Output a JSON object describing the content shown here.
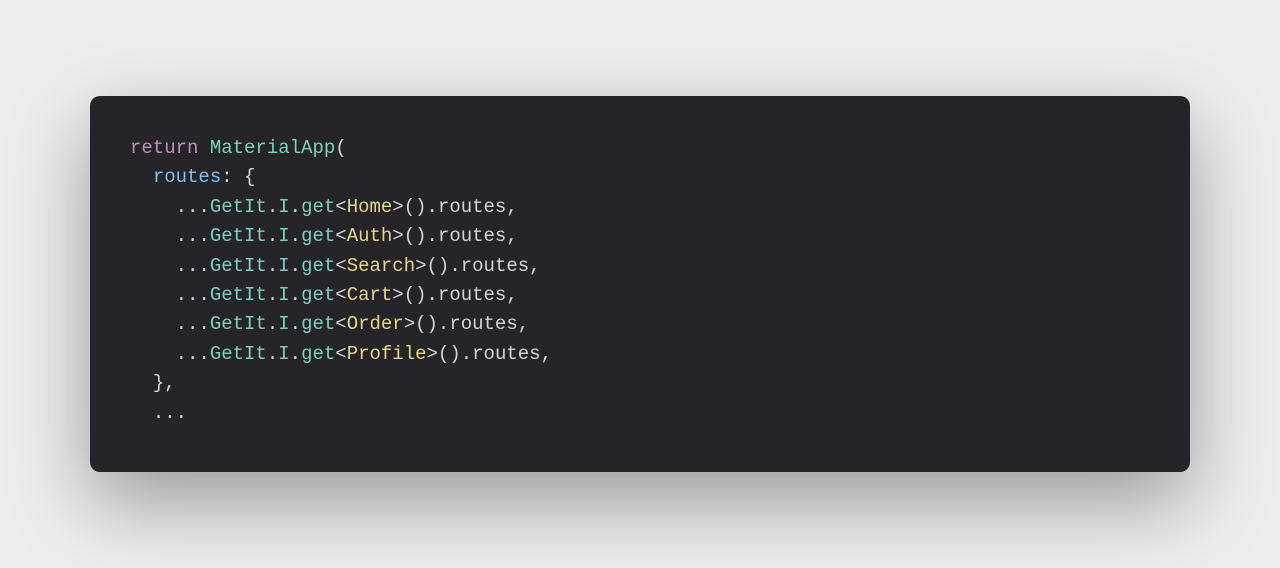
{
  "code": {
    "line1": {
      "return": "return",
      "space": " ",
      "materialApp": "MaterialApp",
      "paren": "("
    },
    "line2": {
      "indent": "  ",
      "routes": "routes",
      "colon_brace": ": {"
    },
    "spread_lines": [
      {
        "indent": "    ",
        "spread": "...",
        "getIt": "GetIt",
        "dot1": ".",
        "I": "I",
        "dot2": ".",
        "get": "get",
        "lt": "<",
        "type": "Home",
        "gt": ">",
        "call": "().",
        "routes": "routes",
        "comma": ","
      },
      {
        "indent": "    ",
        "spread": "...",
        "getIt": "GetIt",
        "dot1": ".",
        "I": "I",
        "dot2": ".",
        "get": "get",
        "lt": "<",
        "type": "Auth",
        "gt": ">",
        "call": "().",
        "routes": "routes",
        "comma": ","
      },
      {
        "indent": "    ",
        "spread": "...",
        "getIt": "GetIt",
        "dot1": ".",
        "I": "I",
        "dot2": ".",
        "get": "get",
        "lt": "<",
        "type": "Search",
        "gt": ">",
        "call": "().",
        "routes": "routes",
        "comma": ","
      },
      {
        "indent": "    ",
        "spread": "...",
        "getIt": "GetIt",
        "dot1": ".",
        "I": "I",
        "dot2": ".",
        "get": "get",
        "lt": "<",
        "type": "Cart",
        "gt": ">",
        "call": "().",
        "routes": "routes",
        "comma": ","
      },
      {
        "indent": "    ",
        "spread": "...",
        "getIt": "GetIt",
        "dot1": ".",
        "I": "I",
        "dot2": ".",
        "get": "get",
        "lt": "<",
        "type": "Order",
        "gt": ">",
        "call": "().",
        "routes": "routes",
        "comma": ","
      },
      {
        "indent": "    ",
        "spread": "...",
        "getIt": "GetIt",
        "dot1": ".",
        "I": "I",
        "dot2": ".",
        "get": "get",
        "lt": "<",
        "type": "Profile",
        "gt": ">",
        "call": "().",
        "routes": "routes",
        "comma": ","
      }
    ],
    "line_close_brace": {
      "indent": "  ",
      "text": "},"
    },
    "line_ellipsis": {
      "indent": "  ",
      "text": "..."
    }
  }
}
